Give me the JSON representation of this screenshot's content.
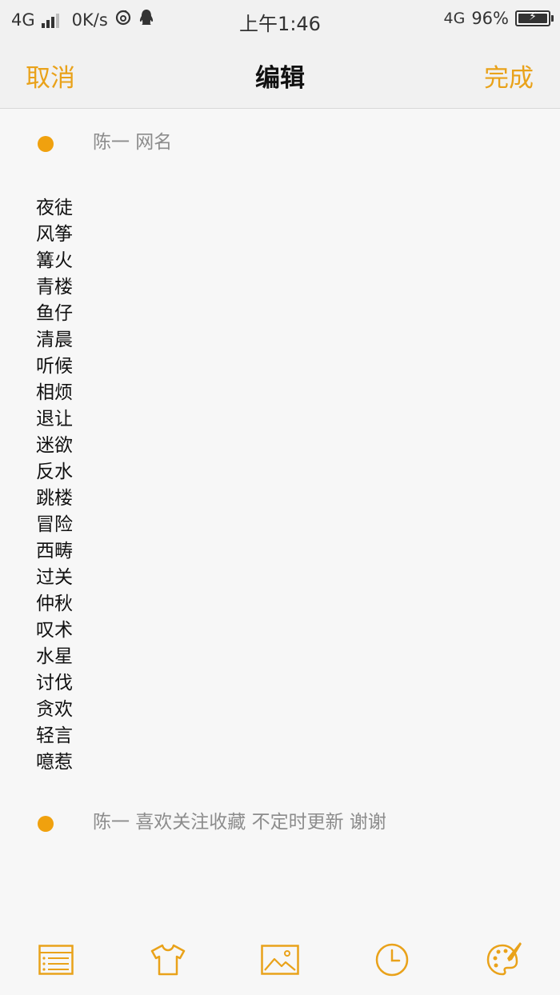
{
  "status_bar": {
    "network_left": "4G",
    "speed": "0K/s",
    "time": "上午1:46",
    "network_right": "4G",
    "battery": "96%"
  },
  "nav": {
    "cancel": "取消",
    "title": "编辑",
    "done": "完成"
  },
  "note": {
    "caption_top": "陈一 网名",
    "words": [
      "夜徒",
      "风筝",
      "篝火",
      "青楼",
      "鱼仔",
      "清晨",
      "听候",
      "相烦",
      "退让",
      "迷欲",
      "反水",
      "跳楼",
      "冒险",
      "西畴",
      "过关",
      "仲秋",
      "叹术",
      "水星",
      "讨伐",
      "贪欢",
      "轻言",
      "噫惹"
    ],
    "caption_bottom": "陈一 喜欢关注收藏 不定时更新 谢谢"
  },
  "toolbar": {
    "icons": [
      "checklist-icon",
      "shirt-icon",
      "image-icon",
      "clock-icon",
      "palette-icon"
    ]
  },
  "colors": {
    "accent": "#e9a21a",
    "dot": "#f0a10e"
  }
}
